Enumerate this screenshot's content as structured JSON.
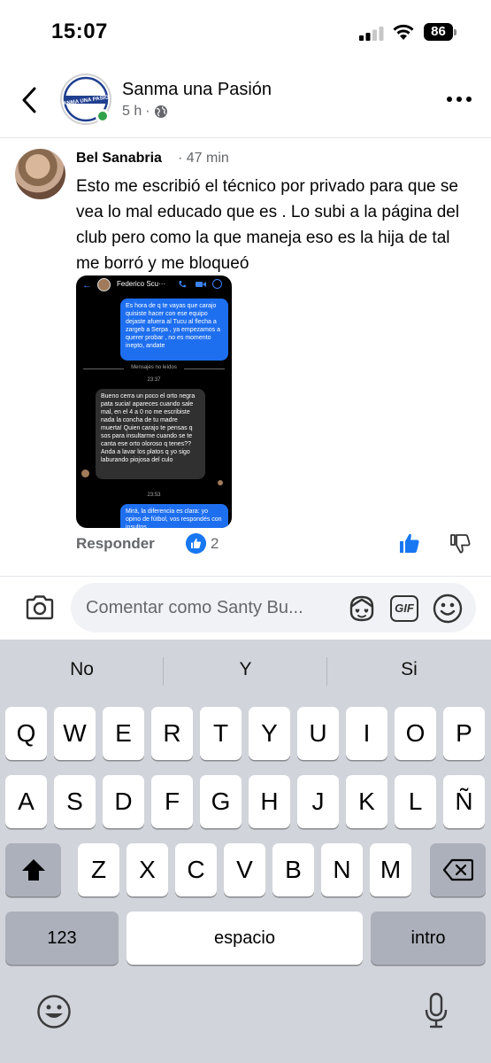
{
  "status_bar": {
    "time": "15:07",
    "battery": "86"
  },
  "post": {
    "page_name": "Sanma una Pasión",
    "age": "5 h",
    "avatar_text": "SANMA UNA PASION"
  },
  "comment": {
    "author": "Bel Sanabria",
    "time": "· 47 min",
    "text": "Esto me escribió el técnico por privado para que se vea lo mal educado que es . Lo subi a la página del club pero como la que maneja eso es la hija de tal me borró y me bloqueó",
    "reply_label": "Responder",
    "like_count": "2"
  },
  "screenshot": {
    "contact_name": "Federico Scu···",
    "msg1": "Es hora de q te vayas que carajo quisiste hacer con ese equipo dejaste afuera al Tucu al flecha a zargeb a Serpa , ya empezamos a querer probar , no es momento inepto, andate",
    "unread": "Mensajes no leídos",
    "ts1": "23:37",
    "msg2": "Bueno cerra un poco el orto negra pata sucia! apareces cuando sale mal, en el 4 a 0 no me escribiste nada la concha de tu madre muerta! Quien carajo te pensas q sos para insultarme cuando se te canta ese orto oloroso q tenes?? Anda a lavar los platos q yo sigo laburando piojosa del culo",
    "ts2": "23:53",
    "msg3": "Mirá, la diferencia es clara: yo opino de fútbol, vos respondés con insultos."
  },
  "composer": {
    "placeholder": "Comentar como Santy Bu..."
  },
  "keyboard": {
    "suggestions": [
      "No",
      "Y",
      "Si"
    ],
    "row1": [
      "Q",
      "W",
      "E",
      "R",
      "T",
      "Y",
      "U",
      "I",
      "O",
      "P"
    ],
    "row2": [
      "A",
      "S",
      "D",
      "F",
      "G",
      "H",
      "J",
      "K",
      "L",
      "Ñ"
    ],
    "row3": [
      "Z",
      "X",
      "C",
      "V",
      "B",
      "N",
      "M"
    ],
    "numbers_label": "123",
    "space_label": "espacio",
    "return_label": "intro"
  },
  "colors": {
    "brand_blue": "#1877f2",
    "online_green": "#31a24c",
    "bubble_blue": "#1e6ff0"
  }
}
